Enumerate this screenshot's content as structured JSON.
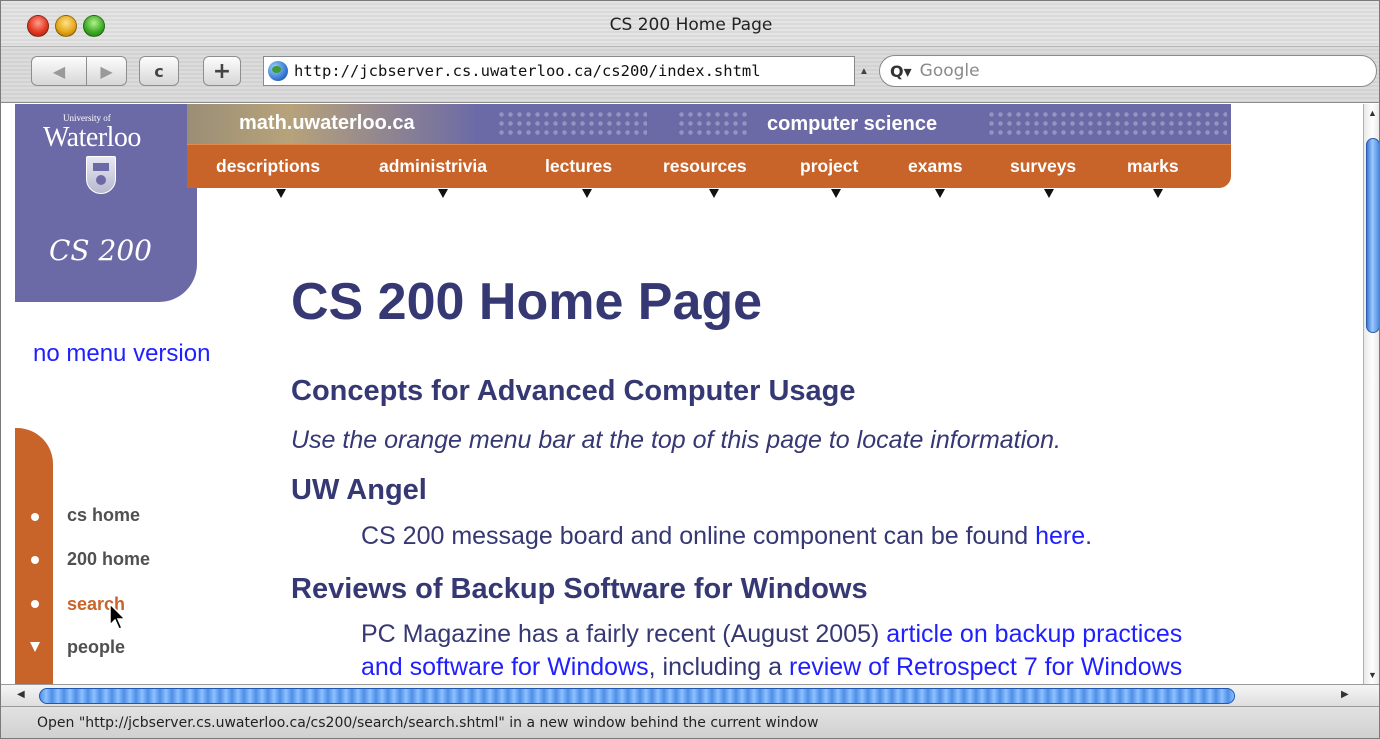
{
  "window": {
    "title": "CS 200 Home Page"
  },
  "toolbar": {
    "back_glyph": "◀",
    "forward_glyph": "▶",
    "reload_glyph": "c",
    "add_glyph": "+",
    "url": "http://jcbserver.cs.uwaterloo.ca/cs200/index.shtml",
    "search_placeholder": "Google",
    "search_glyph": "Q▾"
  },
  "site": {
    "logo_small": "University of",
    "logo_big": "Waterloo",
    "course_logo": "CS 200",
    "banner_left": "math.uwaterloo.ca",
    "banner_right": "computer science",
    "nav": [
      "descriptions",
      "administrivia",
      "lectures",
      "resources",
      "project",
      "exams",
      "surveys",
      "marks"
    ],
    "no_menu_link": "no menu version",
    "side_links": [
      "cs home",
      "200 home",
      "search",
      "people"
    ]
  },
  "content": {
    "title": "CS 200 Home Page",
    "subtitle": "Concepts for Advanced Computer Usage",
    "lead": "Use the orange menu bar at the top of this page to locate information.",
    "angel_heading": "UW Angel",
    "angel_text": "CS 200 message board and online component can be found ",
    "angel_link": "here",
    "angel_end": ".",
    "backup_heading": "Reviews of Backup Software for Windows",
    "backup_text1": "PC Magazine has a fairly recent (August 2005) ",
    "backup_link1a": "article on backup practices",
    "backup_link1b": "and software for Windows",
    "backup_text2": ", including a ",
    "backup_link2": "review of Retrospect 7 for Windows"
  },
  "status": {
    "text": "Open \"http://jcbserver.cs.uwaterloo.ca/cs200/search/search.shtml\" in a new window behind the current window"
  },
  "colors": {
    "purple": "#6c6aa6",
    "orange": "#c8642a",
    "heading": "#353873",
    "link": "#1f1fff"
  }
}
